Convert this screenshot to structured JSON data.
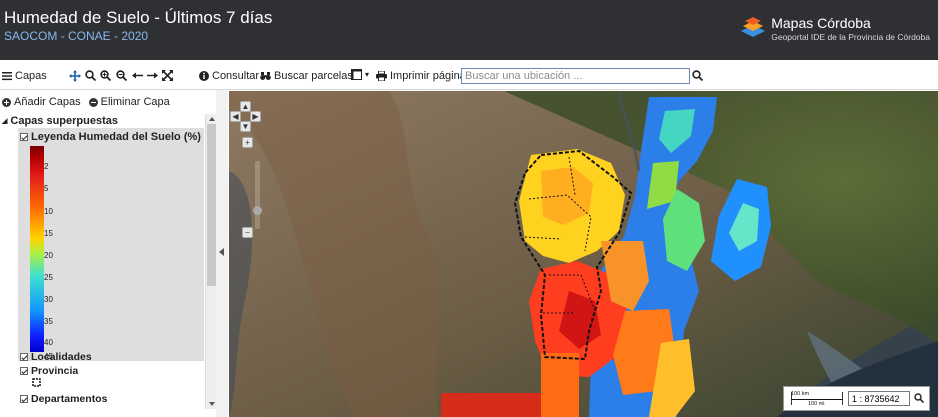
{
  "header": {
    "title": "Humedad de Suelo - Últimos 7 días",
    "subtitle": "SAOCOM - CONAE - 2020",
    "brand": {
      "name": "Mapas Córdoba",
      "tagline": "Geoportal IDE de la Provincia de Córdoba"
    }
  },
  "toolbar": {
    "layers_label": "Capas",
    "consultar_label": "Consultar",
    "buscar_parcelas_label": "Buscar parcelas",
    "imprimir_label": "Imprimir página",
    "search_placeholder": "Buscar una ubicación ..."
  },
  "sidebar": {
    "add_layers_label": "Añadir Capas",
    "remove_layer_label": "Eliminar Capa",
    "group_label": "Capas superpuestas",
    "legend": {
      "title": "Leyenda Humedad del Suelo (%)",
      "ticks": [
        "2",
        "5",
        "10",
        "15",
        "20",
        "25",
        "30",
        "35",
        "40",
        "45"
      ]
    },
    "layers": [
      {
        "label": "Localidades"
      },
      {
        "label": "Provincia"
      },
      {
        "label": "Departamentos"
      }
    ]
  },
  "map": {
    "scale": {
      "km_label": "100 km",
      "mi_label": "100 mi",
      "ratio": "1 : 8735642"
    }
  },
  "colors": {
    "header_bg": "#2f3033",
    "subtitle": "#86b7ee",
    "brand_accent": "#f05d22"
  }
}
